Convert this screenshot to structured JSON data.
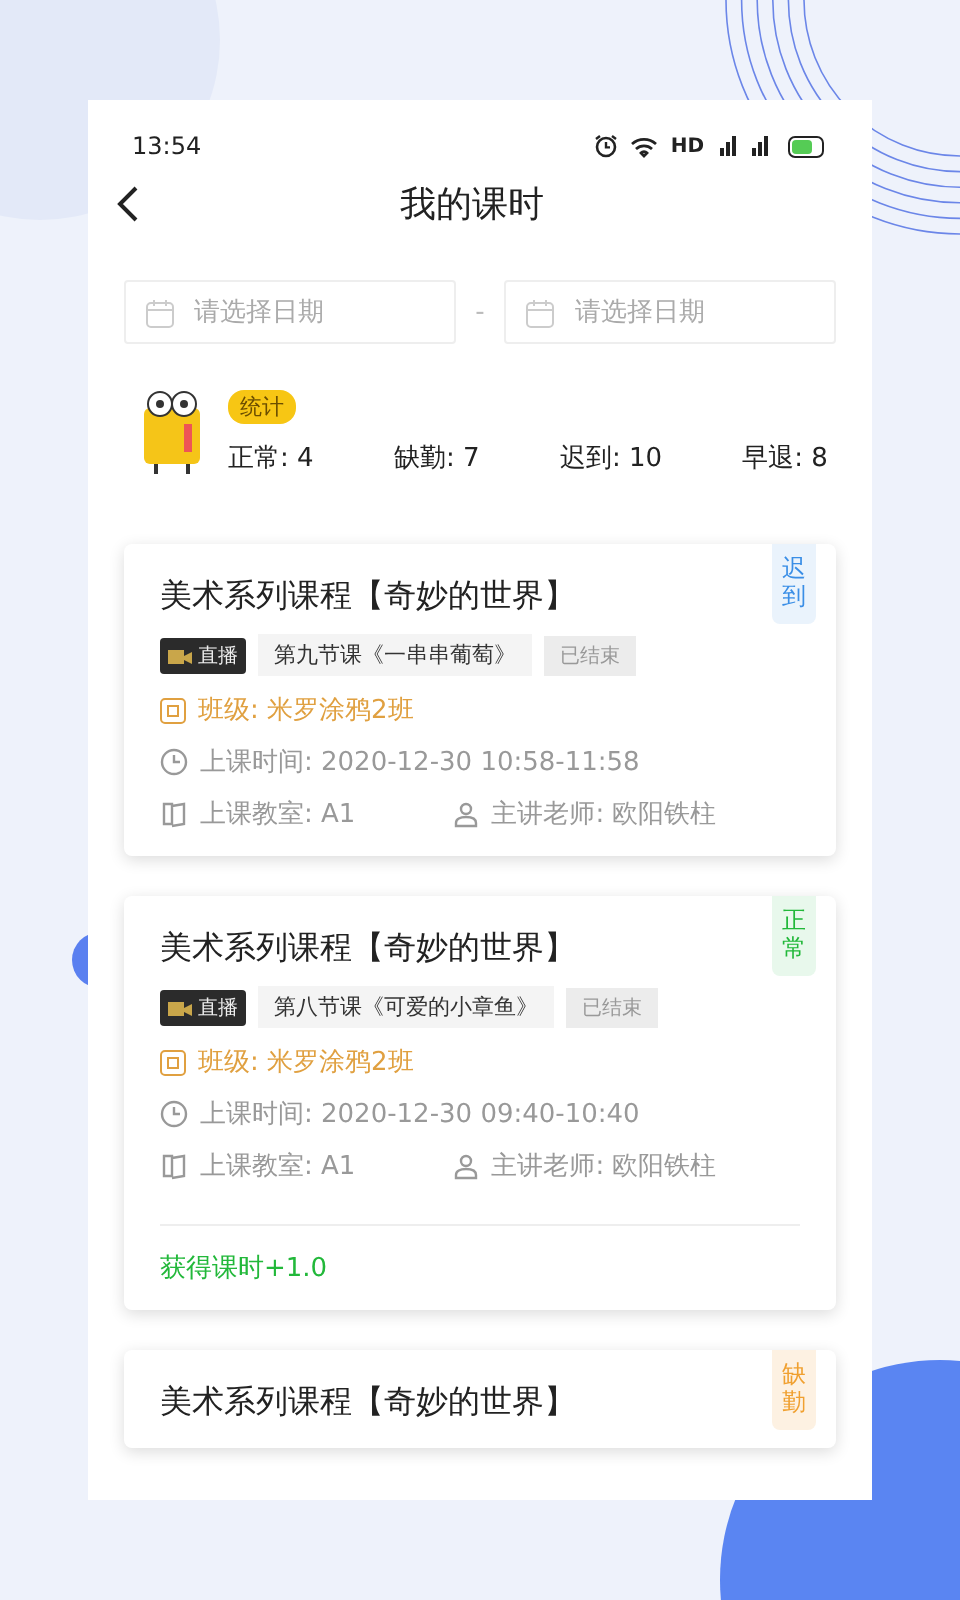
{
  "status_bar": {
    "time": "13:54",
    "network": "HD"
  },
  "header": {
    "title": "我的课时"
  },
  "date_range": {
    "start": {
      "placeholder": "请选择日期"
    },
    "separator": "-",
    "end": {
      "placeholder": "请选择日期"
    }
  },
  "stats": {
    "badge": "统计",
    "items": [
      {
        "label": "正常: 4"
      },
      {
        "label": "缺勤: 7"
      },
      {
        "label": "迟到: 10"
      },
      {
        "label": "早退: 8"
      }
    ]
  },
  "lessons": [
    {
      "title": "美术系列课程【奇妙的世界】",
      "status": "迟到",
      "kind": "late",
      "live": "直播",
      "lesson": "第九节课《一串串葡萄》",
      "state": "已结束",
      "class_name": "班级: 米罗涂鸦2班",
      "time": "上课时间: 2020-12-30 10:58-11:58",
      "room": "上课教室: A1",
      "teacher": "主讲老师: 欧阳铁柱"
    },
    {
      "title": "美术系列课程【奇妙的世界】",
      "status": "正常",
      "kind": "normal",
      "live": "直播",
      "lesson": "第八节课《可爱的小章鱼》",
      "state": "已结束",
      "class_name": "班级: 米罗涂鸦2班",
      "time": "上课时间: 2020-12-30 09:40-10:40",
      "room": "上课教室: A1",
      "teacher": "主讲老师: 欧阳铁柱",
      "reward": "获得课时+1.0"
    },
    {
      "title": "美术系列课程【奇妙的世界】",
      "status": "缺勤",
      "kind": "absent"
    }
  ]
}
